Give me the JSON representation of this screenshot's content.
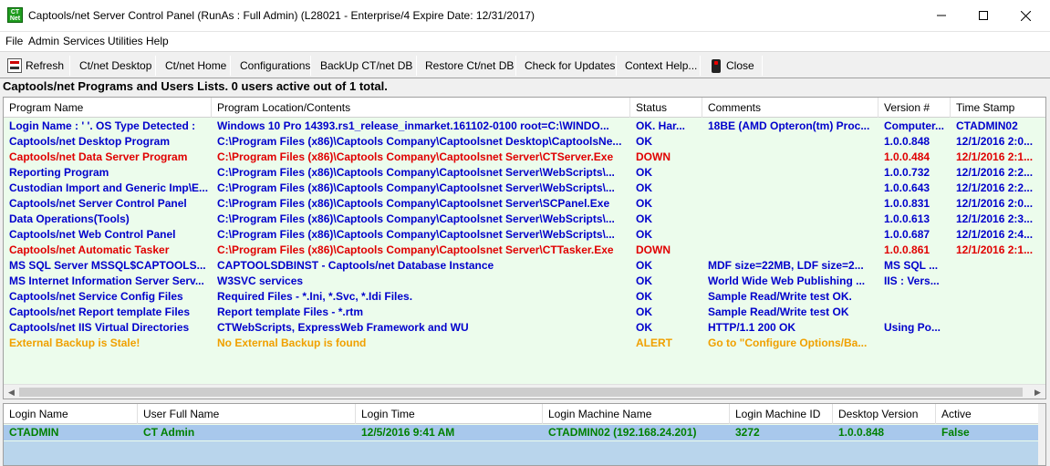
{
  "window": {
    "title": "Captools/net Server Control Panel (RunAs : Full Admin) (L28021 - Enterprise/4 Expire Date: 12/31/2017)",
    "icon_text": "CT Net",
    "controls": [
      "minimize-icon",
      "maximize-icon",
      "close-icon"
    ]
  },
  "menu": [
    "File",
    "Admin",
    "Services",
    "Utilities",
    "Help"
  ],
  "toolbar": {
    "refresh": "Refresh",
    "ctnet_desktop": "Ct/net Desktop",
    "ctnet_home": "Ct/net Home",
    "configurations": "Configurations",
    "backup_db": "BackUp CT/net DB",
    "restore_db": "Restore Ct/net DB",
    "check_updates": "Check for Updates",
    "context_help": "Context Help...",
    "close": "Close"
  },
  "status_line": "Captools/net Programs and Users Lists. 0 users active out of 1 total.",
  "colors": {
    "ok": "#0000cc",
    "down": "#e00000",
    "alert": "#f0a000",
    "panel_bg": "#ecfcec",
    "selected_row": "#a8c8ec",
    "user_text": "#008000"
  },
  "programs": {
    "headers": [
      "Program Name",
      "Program Location/Contents",
      "Status",
      "Comments",
      "Version #",
      "Time Stamp"
    ],
    "rows": [
      {
        "name": "Login Name : ' '. OS Type Detected :",
        "location": "Windows 10 Pro  14393.rs1_release_inmarket.161102-0100 root=C:\\WINDO...",
        "status": "OK.  Har...",
        "comments": "18BE (AMD Opteron(tm) Proc...",
        "version": "Computer...",
        "timestamp": "CTADMIN02",
        "color": "#0000cc"
      },
      {
        "name": "Captools/net Desktop Program",
        "location": "C:\\Program Files (x86)\\Captools Company\\Captoolsnet Desktop\\CaptoolsNe...",
        "status": "OK",
        "comments": "",
        "version": "1.0.0.848",
        "timestamp": "12/1/2016 2:0...",
        "color": "#0000cc"
      },
      {
        "name": "Captools/net Data Server Program",
        "location": "C:\\Program Files (x86)\\Captools Company\\Captoolsnet Server\\CTServer.Exe",
        "status": "DOWN",
        "comments": "",
        "version": "1.0.0.484",
        "timestamp": "12/1/2016 2:1...",
        "color": "#e00000"
      },
      {
        "name": "Reporting Program",
        "location": "C:\\Program Files (x86)\\Captools Company\\Captoolsnet Server\\WebScripts\\...",
        "status": "OK",
        "comments": "",
        "version": "1.0.0.732",
        "timestamp": "12/1/2016 2:2...",
        "color": "#0000cc"
      },
      {
        "name": "Custodian Import and Generic Imp\\E...",
        "location": "C:\\Program Files (x86)\\Captools Company\\Captoolsnet Server\\WebScripts\\...",
        "status": "OK",
        "comments": "",
        "version": "1.0.0.643",
        "timestamp": "12/1/2016 2:2...",
        "color": "#0000cc"
      },
      {
        "name": "Captools/net Server Control Panel",
        "location": "C:\\Program Files (x86)\\Captools Company\\Captoolsnet Server\\SCPanel.Exe",
        "status": "OK",
        "comments": "",
        "version": "1.0.0.831",
        "timestamp": "12/1/2016 2:0...",
        "color": "#0000cc"
      },
      {
        "name": "Data Operations(Tools)",
        "location": "C:\\Program Files (x86)\\Captools Company\\Captoolsnet Server\\WebScripts\\...",
        "status": "OK",
        "comments": "",
        "version": "1.0.0.613",
        "timestamp": "12/1/2016 2:3...",
        "color": "#0000cc"
      },
      {
        "name": "Captools/net Web Control Panel",
        "location": "C:\\Program Files (x86)\\Captools Company\\Captoolsnet Server\\WebScripts\\...",
        "status": "OK",
        "comments": "",
        "version": "1.0.0.687",
        "timestamp": "12/1/2016 2:4...",
        "color": "#0000cc"
      },
      {
        "name": "Captools/net Automatic Tasker",
        "location": "C:\\Program Files (x86)\\Captools Company\\Captoolsnet Server\\CTTasker.Exe",
        "status": "DOWN",
        "comments": "",
        "version": "1.0.0.861",
        "timestamp": "12/1/2016 2:1...",
        "color": "#e00000"
      },
      {
        "name": "MS SQL Server MSSQL$CAPTOOLS...",
        "location": "CAPTOOLSDBINST - Captools/net Database Instance",
        "status": "OK",
        "comments": "MDF size=22MB, LDF size=2...",
        "version": "MS SQL ...",
        "timestamp": "",
        "color": "#0000cc"
      },
      {
        "name": "MS Internet Information Server Serv...",
        "location": "W3SVC services",
        "status": "OK",
        "comments": "World Wide Web Publishing ...",
        "version": "IIS : Vers...",
        "timestamp": "",
        "color": "#0000cc"
      },
      {
        "name": "Captools/net Service Config Files",
        "location": "Required Files - *.Ini, *.Svc, *.Idi Files.",
        "status": "OK",
        "comments": "Sample Read/Write test OK.",
        "version": "",
        "timestamp": "",
        "color": "#0000cc"
      },
      {
        "name": "Captools/net Report template Files",
        "location": "Report template Files - *.rtm",
        "status": "OK",
        "comments": "Sample Read/Write test OK",
        "version": "",
        "timestamp": "",
        "color": "#0000cc"
      },
      {
        "name": "Captools/net IIS Virtual Directories",
        "location": "CTWebScripts, ExpressWeb Framework and WU",
        "status": "OK",
        "comments": "HTTP/1.1 200 OK",
        "version": "Using Po...",
        "timestamp": "",
        "color": "#0000cc"
      },
      {
        "name": "External Backup is Stale!",
        "location": "No External Backup is found",
        "status": "ALERT",
        "comments": "Go to \"Configure Options/Ba...",
        "version": "",
        "timestamp": "",
        "color": "#f0a000"
      }
    ]
  },
  "users": {
    "headers": [
      "Login Name",
      "User Full Name",
      "Login Time",
      "Login Machine Name",
      "Login Machine ID",
      "Desktop Version",
      "Active"
    ],
    "rows": [
      {
        "login_name": "CTADMIN",
        "full_name": "CT Admin",
        "login_time": "12/5/2016 9:41 AM",
        "machine_name": "CTADMIN02 (192.168.24.201)",
        "machine_id": "3272",
        "desktop_version": "1.0.0.848",
        "active": "False"
      }
    ]
  }
}
